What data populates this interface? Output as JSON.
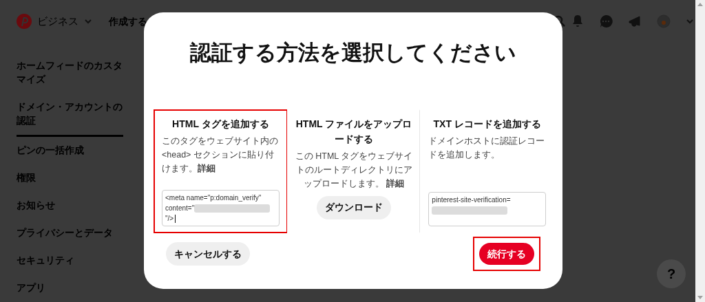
{
  "header": {
    "brand": "ビジネス",
    "create": "作成する"
  },
  "sidebar": {
    "items": [
      {
        "label": "ホームフィードのカスタマイズ",
        "selected": false
      },
      {
        "label": "ドメイン・アカウントの認証",
        "selected": true
      },
      {
        "label": "ピンの一括作成",
        "selected": false
      },
      {
        "label": "権限",
        "selected": false
      },
      {
        "label": "お知らせ",
        "selected": false
      },
      {
        "label": "プライバシーとデータ",
        "selected": false
      },
      {
        "label": "セキュリティ",
        "selected": false
      },
      {
        "label": "アプリ",
        "selected": false
      }
    ]
  },
  "modal": {
    "title": "認証する方法を選択してください",
    "methods": [
      {
        "kind": "field",
        "title": "HTML タグを追加する",
        "description": "このタグをウェブサイト内の <head> セクションに貼り付けます。**詳細**",
        "highlighted": true,
        "field": {
          "focused": true,
          "segments": [
            {
              "kind": "text",
              "text": "<meta name=\"p:domain_verify\" content=\""
            },
            {
              "kind": "redacted"
            },
            {
              "kind": "text",
              "text": "\"/>"
            }
          ]
        }
      },
      {
        "kind": "download",
        "title": "HTML ファイルをアップロードする",
        "description": "この HTML タグをウェブサイトのルートディレクトリにアップロードします。 **詳細**",
        "highlighted": false,
        "button": "ダウンロード"
      },
      {
        "kind": "field",
        "title": "TXT レコードを追加する",
        "description": "ドメインホストに認証レコードを追加します。",
        "highlighted": false,
        "field": {
          "focused": false,
          "segments": [
            {
              "kind": "text",
              "text": "pinterest-site-verification="
            },
            {
              "kind": "redacted"
            }
          ]
        }
      }
    ],
    "cancel": {
      "label": "キャンセルする",
      "highlighted": false
    },
    "continue": {
      "label": "続行する",
      "highlighted": true
    }
  },
  "help": "?"
}
